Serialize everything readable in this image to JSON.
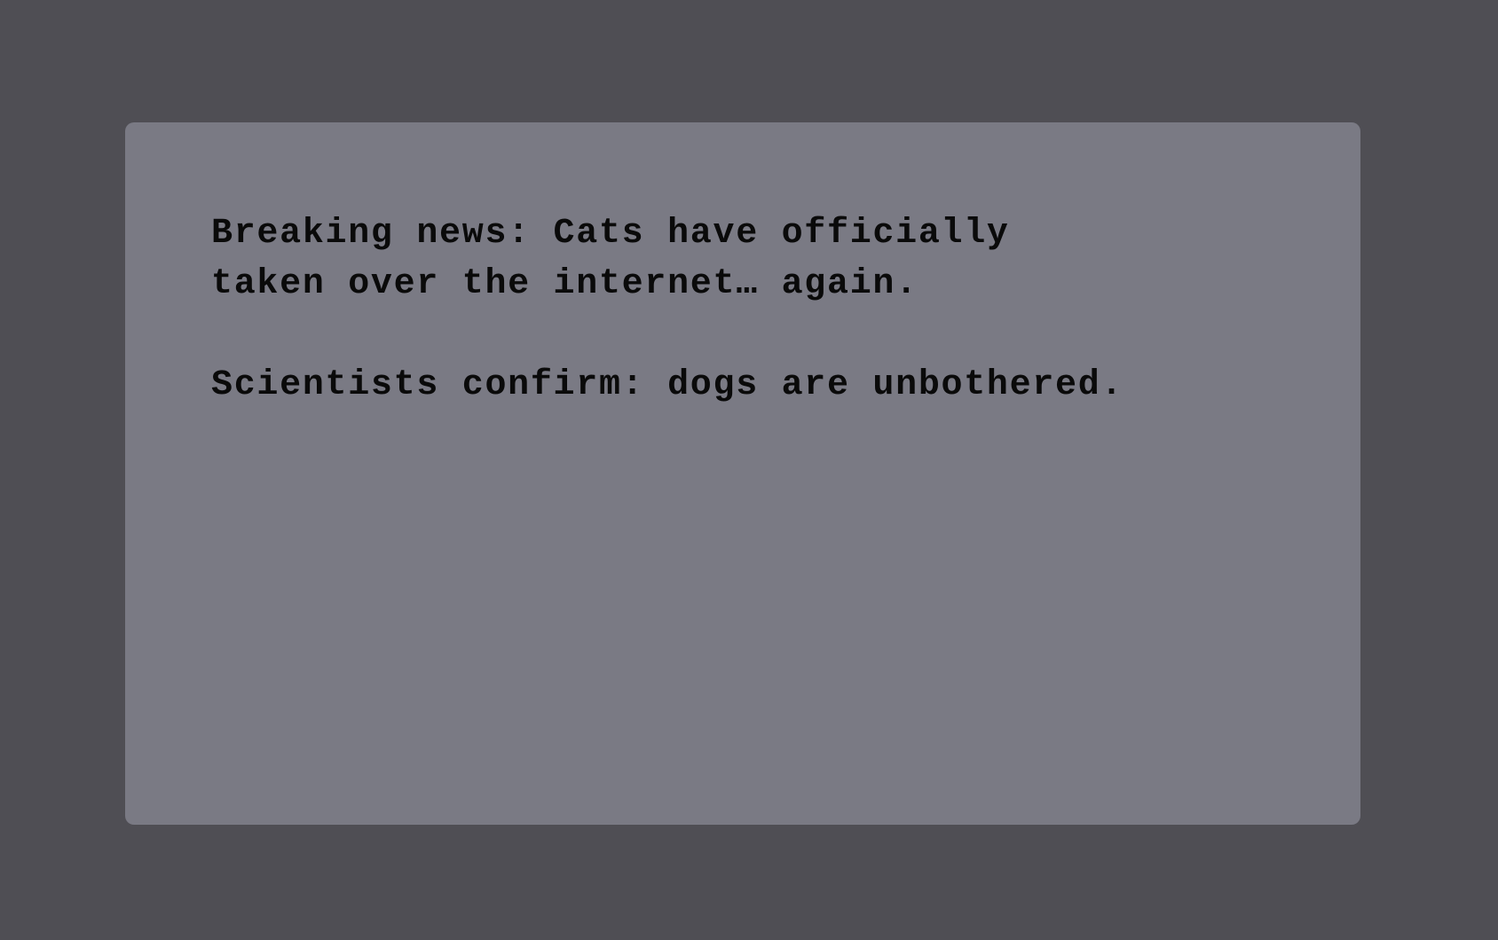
{
  "message": {
    "headline_line1": "Breaking news: Cats have officially",
    "headline_line2": "taken over the internet… again.",
    "subline": "Scientists confirm: dogs are unbothered."
  },
  "colors": {
    "background": "#4f4e54",
    "card": "#7a7a84",
    "text": "#0a0a0a"
  }
}
